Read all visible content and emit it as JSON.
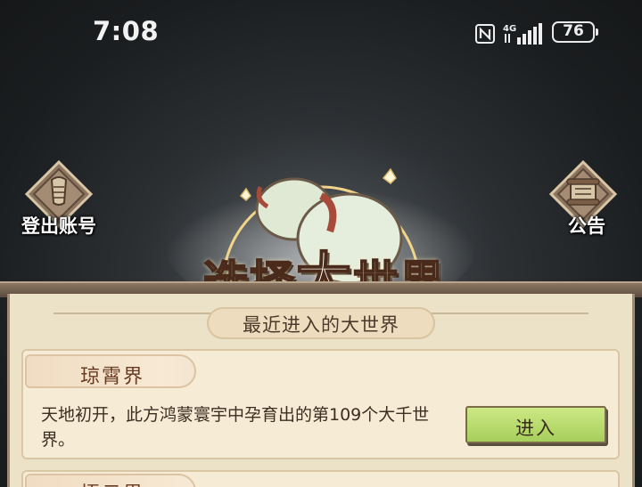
{
  "status_bar": {
    "time": "7:08",
    "network": "4G",
    "battery": "76"
  },
  "top_buttons": {
    "logout_label": "登出账号",
    "notice_label": "公告"
  },
  "banner": {
    "title_left": "选择",
    "title_big": "大",
    "title_right": "世界"
  },
  "panel": {
    "heading": "最近进入的大世界",
    "worlds": [
      {
        "name": "琼霄界",
        "description": "天地初开，此方鸿蒙寰宇中孕育出的第109个大千世界。",
        "enter_label": "进入"
      },
      {
        "name": "悟云界"
      }
    ]
  },
  "colors": {
    "background": "#1b1e20",
    "panel": "#ece2c8",
    "enter_button": "#b5d86b",
    "text_brown": "#3e2d21"
  }
}
